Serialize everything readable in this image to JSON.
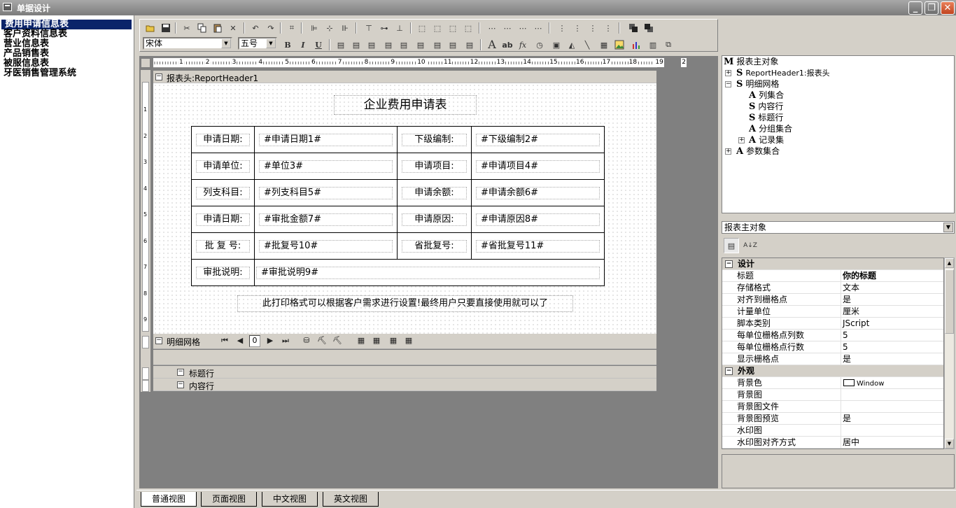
{
  "window": {
    "title": "单据设计",
    "min": "_",
    "max": "❐",
    "close": "✕"
  },
  "left_list": [
    "费用申请信息表",
    "客户资料信息表",
    "营业信息表",
    "产品销售表",
    "被服信息表",
    "牙医销售管理系统"
  ],
  "toolbar": {
    "font_name": "宋体",
    "font_size": "五号",
    "bold": "B",
    "italic": "I",
    "underline": "U",
    "text_tool": "A",
    "ab_tool": "ab",
    "fx_tool": "fx"
  },
  "ruler": {
    "marks": [
      "1",
      "2",
      "3",
      "4",
      "5",
      "6",
      "7",
      "8",
      "9",
      "10",
      "11",
      "12",
      "13",
      "14",
      "15",
      "16",
      "17",
      "18",
      "19",
      "2"
    ],
    "vmarks": [
      "1",
      "2",
      "3",
      "4",
      "5",
      "6",
      "7",
      "8",
      "9"
    ]
  },
  "report": {
    "header_band": "报表头:ReportHeader1",
    "title": "企业费用申请表",
    "rows": [
      [
        "申请日期:",
        "#申请日期1#",
        "下级编制:",
        "#下级编制2#"
      ],
      [
        "申请单位:",
        "#单位3#",
        "申请项目:",
        "#申请项目4#"
      ],
      [
        "列支科目:",
        "#列支科目5#",
        "申请余额:",
        "#申请余额6#"
      ],
      [
        "申请日期:",
        "#审批金额7#",
        "申请原因:",
        "#申请原因8#"
      ],
      [
        "批 复 号:",
        "#批复号10#",
        "省批复号:",
        "#省批复号11#"
      ]
    ],
    "approval_label": "审批说明:",
    "approval_value": "#审批说明9#",
    "note": "此打印格式可以根据客户需求进行设置!最终用户只要直接使用就可以了",
    "detail_band": "明细网格",
    "page_value": "0",
    "sub_band_title": "标题行",
    "sub_band_content": "内容行"
  },
  "tree": {
    "root": {
      "key": "M",
      "label": "报表主对象"
    },
    "nodes": [
      {
        "key": "S",
        "label": "ReportHeader1:报表头"
      },
      {
        "key": "S",
        "label": "明细网格"
      },
      {
        "key": "A",
        "label": "列集合"
      },
      {
        "key": "S",
        "label": "内容行"
      },
      {
        "key": "S",
        "label": "标题行"
      },
      {
        "key": "A",
        "label": "分组集合"
      },
      {
        "key": "A",
        "label": "记录集"
      },
      {
        "key": "A",
        "label": "参数集合"
      }
    ]
  },
  "props": {
    "object": "报表主对象",
    "sort_icon": "A↓Z",
    "rows": [
      {
        "cat": true,
        "k": "设计",
        "v": ""
      },
      {
        "k": "标题",
        "v": "你的标题",
        "bold": true
      },
      {
        "k": "存储格式",
        "v": "文本"
      },
      {
        "k": "对齐到栅格点",
        "v": "是"
      },
      {
        "k": "计量单位",
        "v": "厘米"
      },
      {
        "k": "脚本类别",
        "v": "JScript"
      },
      {
        "k": "每单位栅格点列数",
        "v": "5"
      },
      {
        "k": "每单位栅格点行数",
        "v": "5"
      },
      {
        "k": "显示栅格点",
        "v": "是"
      },
      {
        "cat": true,
        "k": "外观",
        "v": ""
      },
      {
        "k": "背景色",
        "v": "Window",
        "swatch": true
      },
      {
        "k": "背景图",
        "v": ""
      },
      {
        "k": "背景图文件",
        "v": ""
      },
      {
        "k": "背景图预览",
        "v": "是"
      },
      {
        "k": "水印图",
        "v": ""
      },
      {
        "k": "水印图对齐方式",
        "v": "居中"
      }
    ]
  },
  "tabs": [
    "普通视图",
    "页面视图",
    "中文视图",
    "英文视图"
  ]
}
